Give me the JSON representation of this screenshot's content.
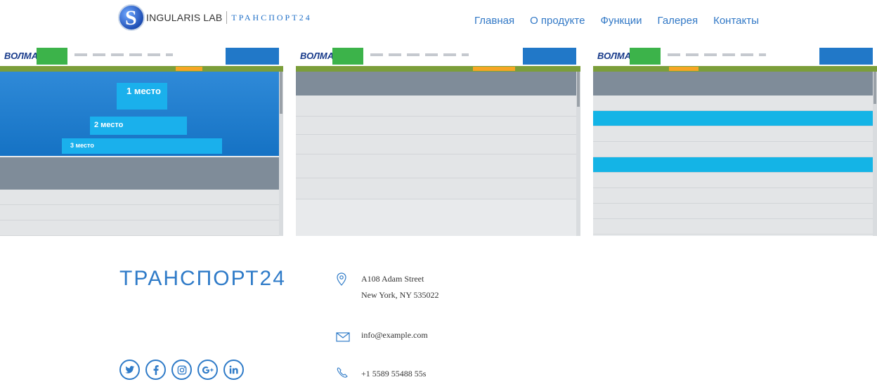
{
  "brand": {
    "name": "INGULARIS LAB",
    "product": "ТРАНСПОРТ24"
  },
  "nav": [
    "Главная",
    "О продукте",
    "Функции",
    "Галерея",
    "Контакты"
  ],
  "gallery": {
    "screens": [
      {
        "brand": "ВОЛМА",
        "places": [
          "1 место",
          "2 место",
          "3 место"
        ]
      },
      {
        "brand": "ВОЛМА"
      },
      {
        "brand": "ВОЛМА"
      }
    ]
  },
  "footer": {
    "title": "ТРАНСПОРТ24",
    "address_line1": "A108 Adam Street",
    "address_line2": "New York, NY 535022",
    "email": "info@example.com",
    "phone": "+1 5589 55488 55s"
  },
  "social": [
    "twitter-icon",
    "facebook-icon",
    "instagram-icon",
    "google-plus-icon",
    "linkedin-icon"
  ],
  "colors": {
    "accent": "#2f7bc8",
    "highlight": "#14b4e6",
    "brand_dark": "#173a8a",
    "green": "#3cb34a"
  }
}
